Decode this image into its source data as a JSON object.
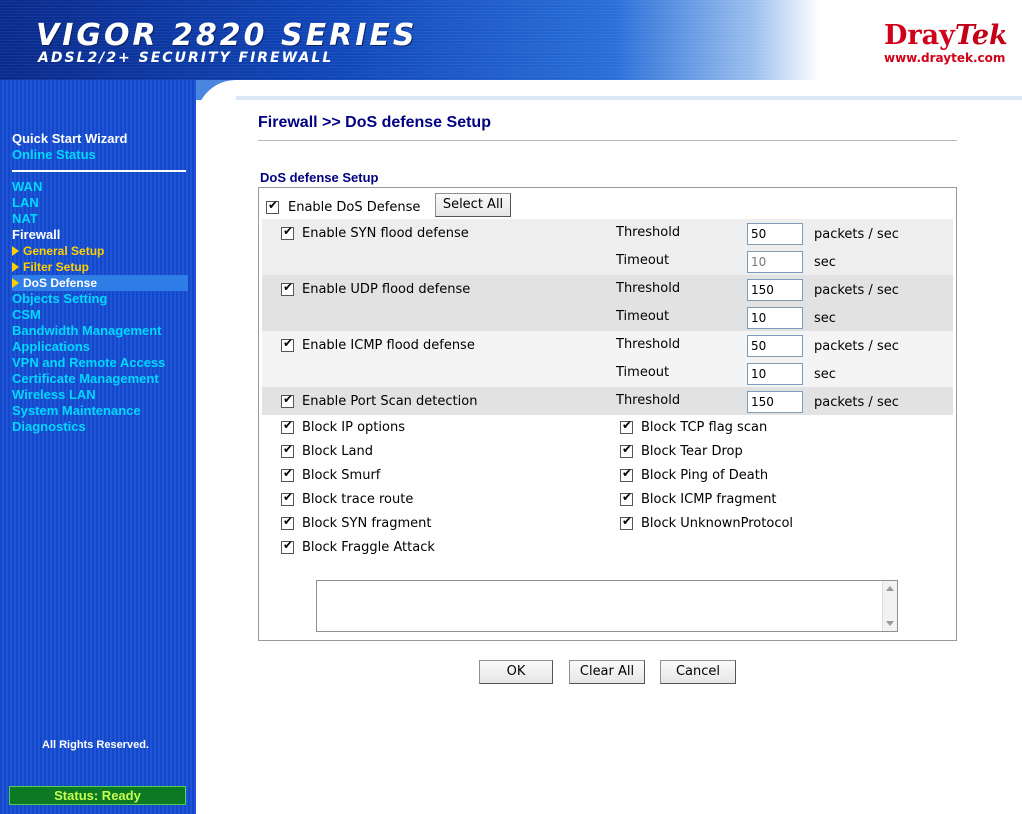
{
  "header": {
    "product_title": "VIGOR 2820 SERIES",
    "product_subtitle": "ADSL2/2+ SECURITY FIREWALL",
    "brand_part1": "Dray",
    "brand_part2": "Tek",
    "brand_url": "www.draytek.com"
  },
  "sidebar": {
    "items": [
      {
        "label": "Quick Start Wizard"
      },
      {
        "label": "Online Status"
      },
      {
        "label": "WAN"
      },
      {
        "label": "LAN"
      },
      {
        "label": "NAT"
      },
      {
        "label": "Firewall"
      },
      {
        "label": "General Setup"
      },
      {
        "label": "Filter Setup"
      },
      {
        "label": "DoS Defense"
      },
      {
        "label": "Objects Setting"
      },
      {
        "label": "CSM"
      },
      {
        "label": "Bandwidth Management"
      },
      {
        "label": "Applications"
      },
      {
        "label": "VPN and Remote Access"
      },
      {
        "label": "Certificate Management"
      },
      {
        "label": "Wireless LAN"
      },
      {
        "label": "System Maintenance"
      },
      {
        "label": "Diagnostics"
      }
    ],
    "rights": "All Rights Reserved.",
    "status": "Status: Ready"
  },
  "page": {
    "title": "Firewall >> DoS defense Setup",
    "section_title": "DoS defense Setup"
  },
  "dos": {
    "enable_label": "Enable DoS Defense",
    "select_all_label": "Select All",
    "threshold_label": "Threshold",
    "timeout_label": "Timeout",
    "pps_unit": "packets / sec",
    "sec_unit": "sec",
    "syn": {
      "label": "Enable SYN flood defense",
      "threshold": "50",
      "timeout": "10"
    },
    "udp": {
      "label": "Enable UDP flood defense",
      "threshold": "150",
      "timeout": "10"
    },
    "icmp": {
      "label": "Enable ICMP flood defense",
      "threshold": "50",
      "timeout": "10"
    },
    "portscan": {
      "label": "Enable Port Scan detection",
      "threshold": "150"
    },
    "blocks_left": [
      "Block IP options",
      "Block Land",
      "Block Smurf",
      "Block trace route",
      "Block SYN fragment",
      "Block Fraggle Attack"
    ],
    "blocks_right": [
      "Block TCP flag scan",
      "Block Tear Drop",
      "Block Ping of Death",
      "Block ICMP fragment",
      "Block UnknownProtocol"
    ]
  },
  "buttons": {
    "ok": "OK",
    "clear_all": "Clear All",
    "cancel": "Cancel"
  },
  "colors": {
    "sidebar_blue": "#1448c8",
    "nav_cyan": "#00d8ff",
    "nav_yellow": "#ffd000",
    "title_navy": "#000080",
    "brand_red": "#d0021b",
    "status_green": "#0c7a24"
  }
}
